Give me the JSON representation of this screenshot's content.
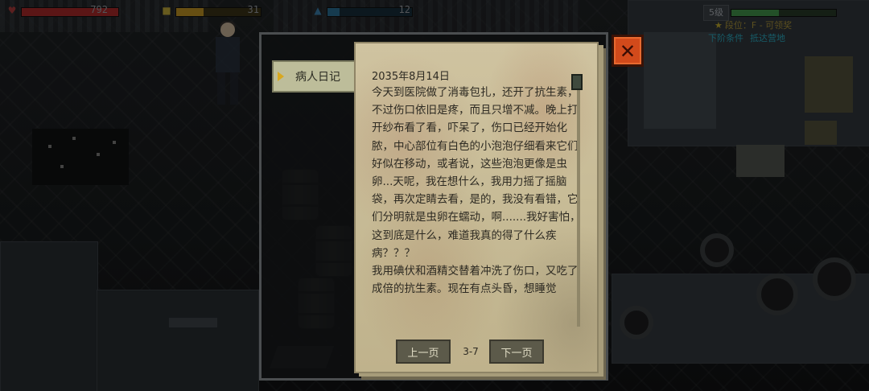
{
  "hud": {
    "health_value": "792",
    "stamina_value": "31",
    "water_value": "12",
    "level_badge": "5级",
    "rank_text": "段位：F - 可领奖",
    "quest_next": "下阶条件",
    "quest_goal": "抵达营地",
    "colors": {
      "health": "#7a1e1e",
      "stamina": "#8a6a1a",
      "water": "#1e4f6a",
      "xp": "#2f6b36"
    }
  },
  "diary": {
    "tab_label": "病人日记",
    "date": "2035年8月14日",
    "body": "今天到医院做了消毒包扎，还开了抗生素，不过伤口依旧是疼，而且只增不减。晚上打开纱布看了看，吓呆了，伤口已经开始化脓，中心部位有白色的小泡泡仔细看来它们好似在移动，或者说，这些泡泡更像是虫卵...天呢，我在想什么，我用力摇了摇脑袋，再次定睛去看，是的，我没有看错，它们分明就是虫卵在蠕动，啊.......我好害怕，这到底是什么，难道我真的得了什么疾病？？？\n我用碘伏和酒精交替着冲洗了伤口，又吃了成倍的抗生素。现在有点头昏，想睡觉",
    "prev_label": "上一页",
    "next_label": "下一页",
    "page_indicator": "3-7"
  },
  "close_icon": "close-x-icon",
  "accent": {
    "close_button": "#d24a1b",
    "tab_arrow": "#d8a820"
  }
}
